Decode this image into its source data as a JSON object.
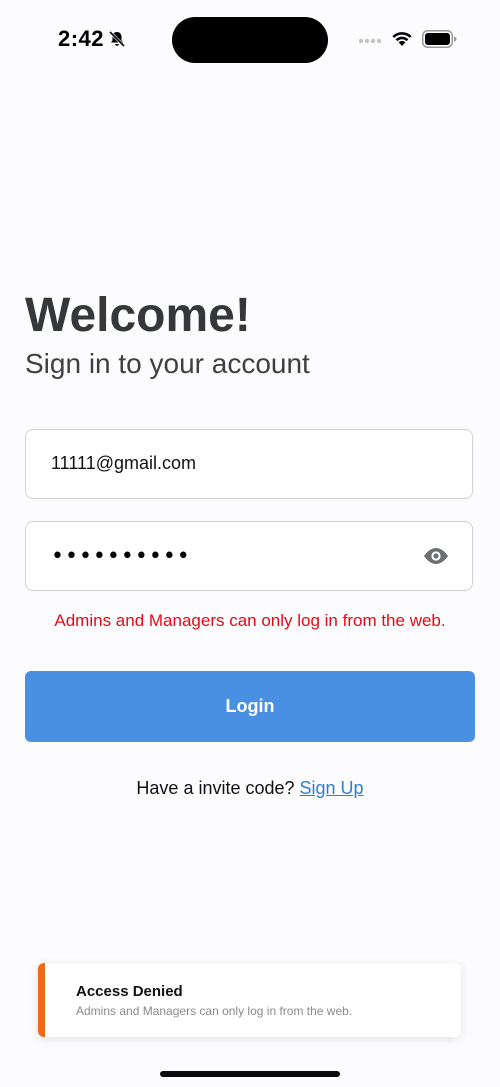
{
  "status_bar": {
    "time": "2:42",
    "icons": [
      "bell-off-icon",
      "signal-dots-icon",
      "wifi-icon",
      "battery-icon"
    ]
  },
  "header": {
    "title": "Welcome!",
    "subtitle": "Sign in to your account"
  },
  "form": {
    "email_value": "11111@gmail.com",
    "password_masked": "••••••••••",
    "password_toggle_icon": "eye-icon",
    "error_message": "Admins and Managers can only log in from the web.",
    "login_label": "Login",
    "invite_prompt": "Have a invite code? ",
    "signup_label": "Sign Up"
  },
  "toast": {
    "title": "Access Denied",
    "message": "Admins and Managers can only log in from the web."
  },
  "colors": {
    "background": "#fcfcfe",
    "primary_button": "#4a90e2",
    "error": "#e50914",
    "link": "#2a7fd4",
    "toast_accent": "#f06a1a"
  }
}
